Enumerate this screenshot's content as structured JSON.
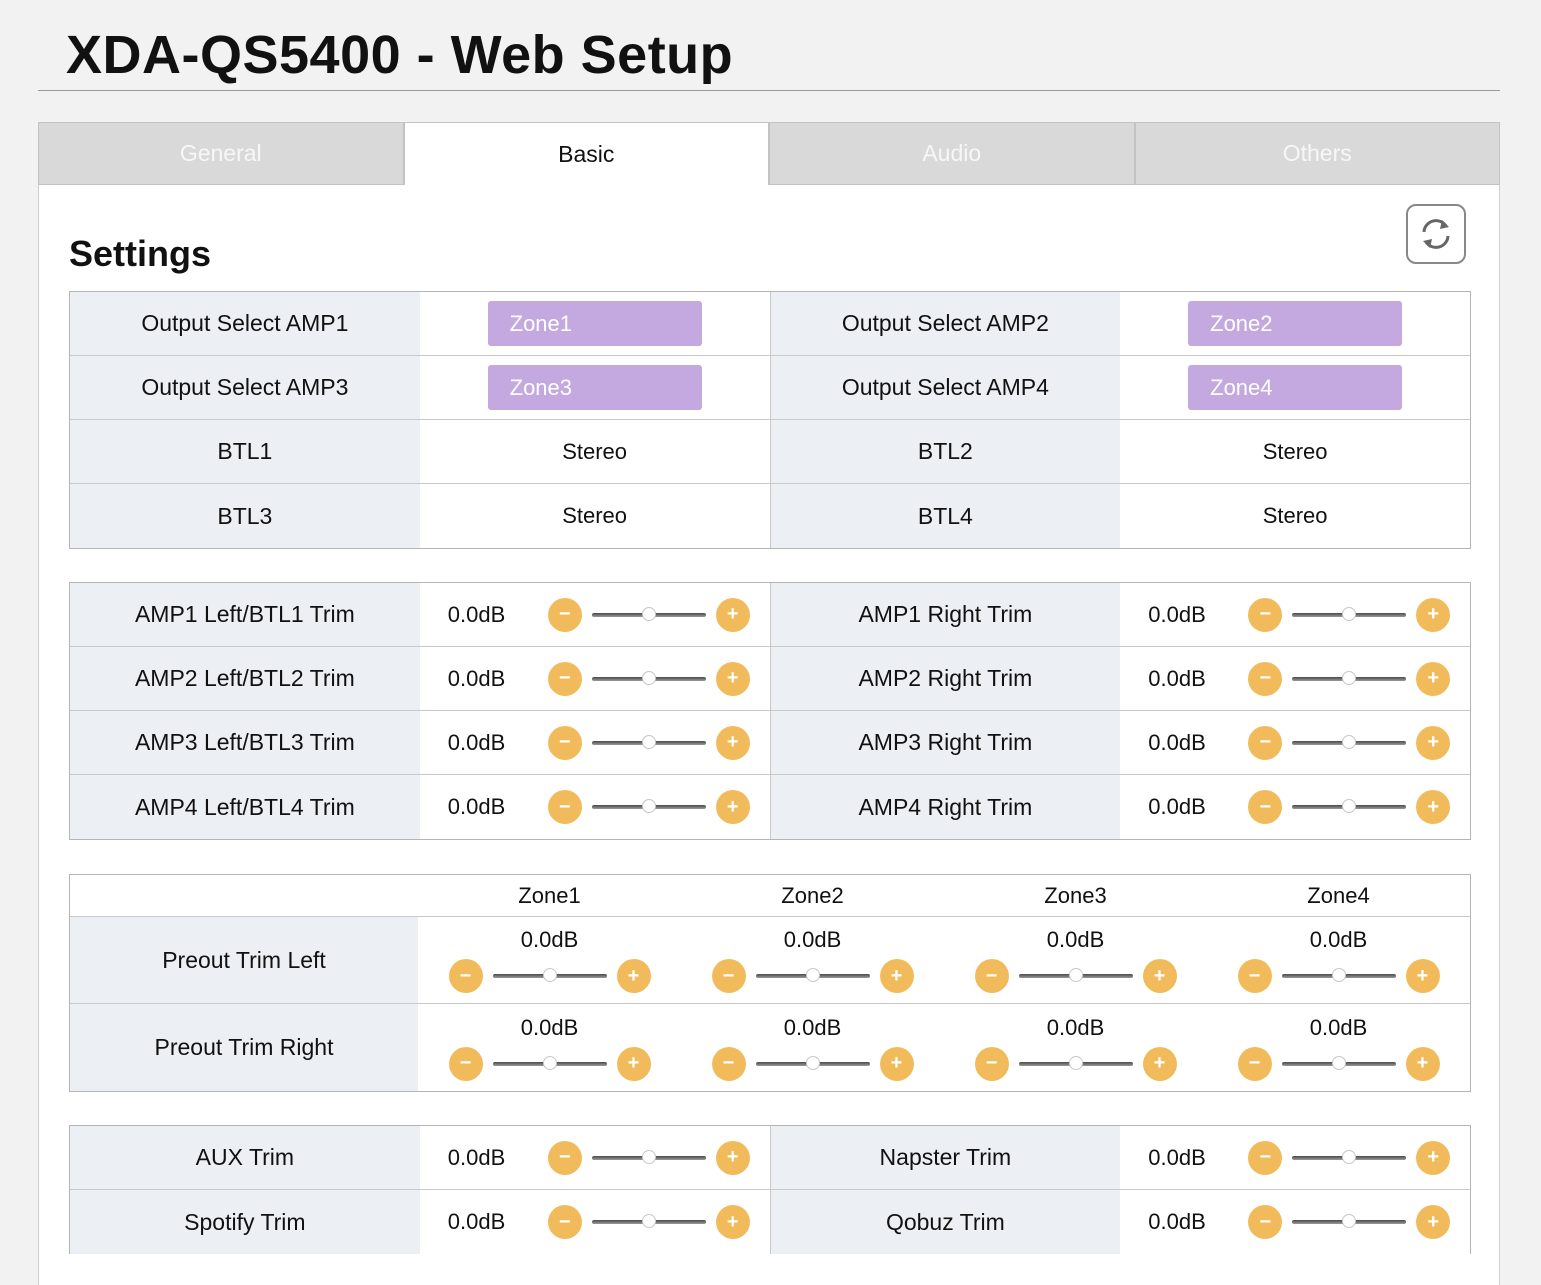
{
  "page_title": "XDA-QS5400 - Web Setup",
  "tabs": [
    {
      "label": "General"
    },
    {
      "label": "Basic"
    },
    {
      "label": "Audio"
    },
    {
      "label": "Others"
    }
  ],
  "active_tab": "Basic",
  "settings_title": "Settings",
  "icons": {
    "refresh": "refresh-icon",
    "minus": "minus-icon",
    "plus": "plus-icon"
  },
  "colors": {
    "zone_button": "#c4a8e0",
    "stepper": "#f1bb5c",
    "label_bg": "#eceff4"
  },
  "output": {
    "amp1_label": "Output Select AMP1",
    "amp1_value": "Zone1",
    "amp2_label": "Output Select AMP2",
    "amp2_value": "Zone2",
    "amp3_label": "Output Select AMP3",
    "amp3_value": "Zone3",
    "amp4_label": "Output Select AMP4",
    "amp4_value": "Zone4",
    "btl1_label": "BTL1",
    "btl1_value": "Stereo",
    "btl2_label": "BTL2",
    "btl2_value": "Stereo",
    "btl3_label": "BTL3",
    "btl3_value": "Stereo",
    "btl4_label": "BTL4",
    "btl4_value": "Stereo"
  },
  "amp_trims": [
    {
      "left_label": "AMP1 Left/BTL1 Trim",
      "left_value": "0.0dB",
      "right_label": "AMP1 Right Trim",
      "right_value": "0.0dB"
    },
    {
      "left_label": "AMP2 Left/BTL2 Trim",
      "left_value": "0.0dB",
      "right_label": "AMP2 Right Trim",
      "right_value": "0.0dB"
    },
    {
      "left_label": "AMP3 Left/BTL3 Trim",
      "left_value": "0.0dB",
      "right_label": "AMP3 Right Trim",
      "right_value": "0.0dB"
    },
    {
      "left_label": "AMP4 Left/BTL4 Trim",
      "left_value": "0.0dB",
      "right_label": "AMP4 Right Trim",
      "right_value": "0.0dB"
    }
  ],
  "preout": {
    "zones": [
      "Zone1",
      "Zone2",
      "Zone3",
      "Zone4"
    ],
    "rows": [
      {
        "label": "Preout Trim Left",
        "values": [
          "0.0dB",
          "0.0dB",
          "0.0dB",
          "0.0dB"
        ]
      },
      {
        "label": "Preout Trim Right",
        "values": [
          "0.0dB",
          "0.0dB",
          "0.0dB",
          "0.0dB"
        ]
      }
    ]
  },
  "source_trims": [
    {
      "left_label": "AUX Trim",
      "left_value": "0.0dB",
      "right_label": "Napster Trim",
      "right_value": "0.0dB"
    },
    {
      "left_label": "Spotify Trim",
      "left_value": "0.0dB",
      "right_label": "Qobuz Trim",
      "right_value": "0.0dB"
    }
  ],
  "slider_level": 0.5
}
